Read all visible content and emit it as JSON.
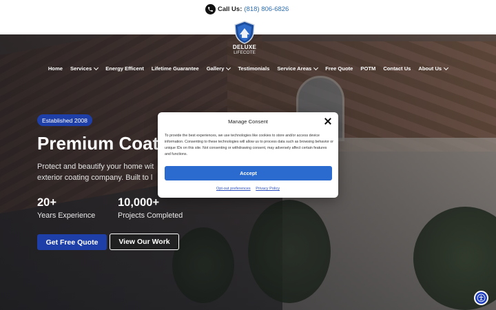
{
  "topbar": {
    "call_label": "Call Us:",
    "phone": "(818) 806-6826"
  },
  "logo": {
    "line1": "DELUXE",
    "line2": "LIFECOTE"
  },
  "nav": [
    {
      "label": "Home",
      "dropdown": false
    },
    {
      "label": "Services",
      "dropdown": true
    },
    {
      "label": "Energy Efficent",
      "dropdown": false
    },
    {
      "label": "Lifetime Guarantee",
      "dropdown": false
    },
    {
      "label": "Gallery",
      "dropdown": true
    },
    {
      "label": "Testimonials",
      "dropdown": false
    },
    {
      "label": "Service Areas",
      "dropdown": true
    },
    {
      "label": "Free Quote",
      "dropdown": false
    },
    {
      "label": "POTM",
      "dropdown": false
    },
    {
      "label": "Contact Us",
      "dropdown": false
    },
    {
      "label": "About Us",
      "dropdown": true
    }
  ],
  "hero": {
    "badge": "Established 2008",
    "headline": "Premium Coat",
    "sub_line1": "Protect and beautify your home wit",
    "sub_line2": "exterior coating company. Built to l",
    "stats": [
      {
        "value": "20+",
        "label": "Years Experience"
      },
      {
        "value": "10,000+",
        "label": "Projects Completed"
      }
    ],
    "primary_cta": "Get Free Quote",
    "secondary_cta": "View Our Work"
  },
  "consent": {
    "title": "Manage Consent",
    "body": "To provide the best experiences, we use technologies like cookies to store and/or access device information. Consenting to these technologies will allow us to process data such as browsing behavior or unique IDs on this site. Not consenting or withdrawing consent, may adversely affect certain features and functions.",
    "accept_label": "Accept",
    "link_optout": "Opt-out preferences",
    "link_privacy": "Privacy Policy"
  },
  "colors": {
    "brand_blue": "#1e3fa8",
    "accept_blue": "#2b6bd0",
    "phone_link": "#2b6cb0"
  },
  "icons": {
    "phone": "phone-icon",
    "close": "close-icon",
    "accessibility": "accessibility-icon",
    "chevron": "chevron-down-icon"
  }
}
